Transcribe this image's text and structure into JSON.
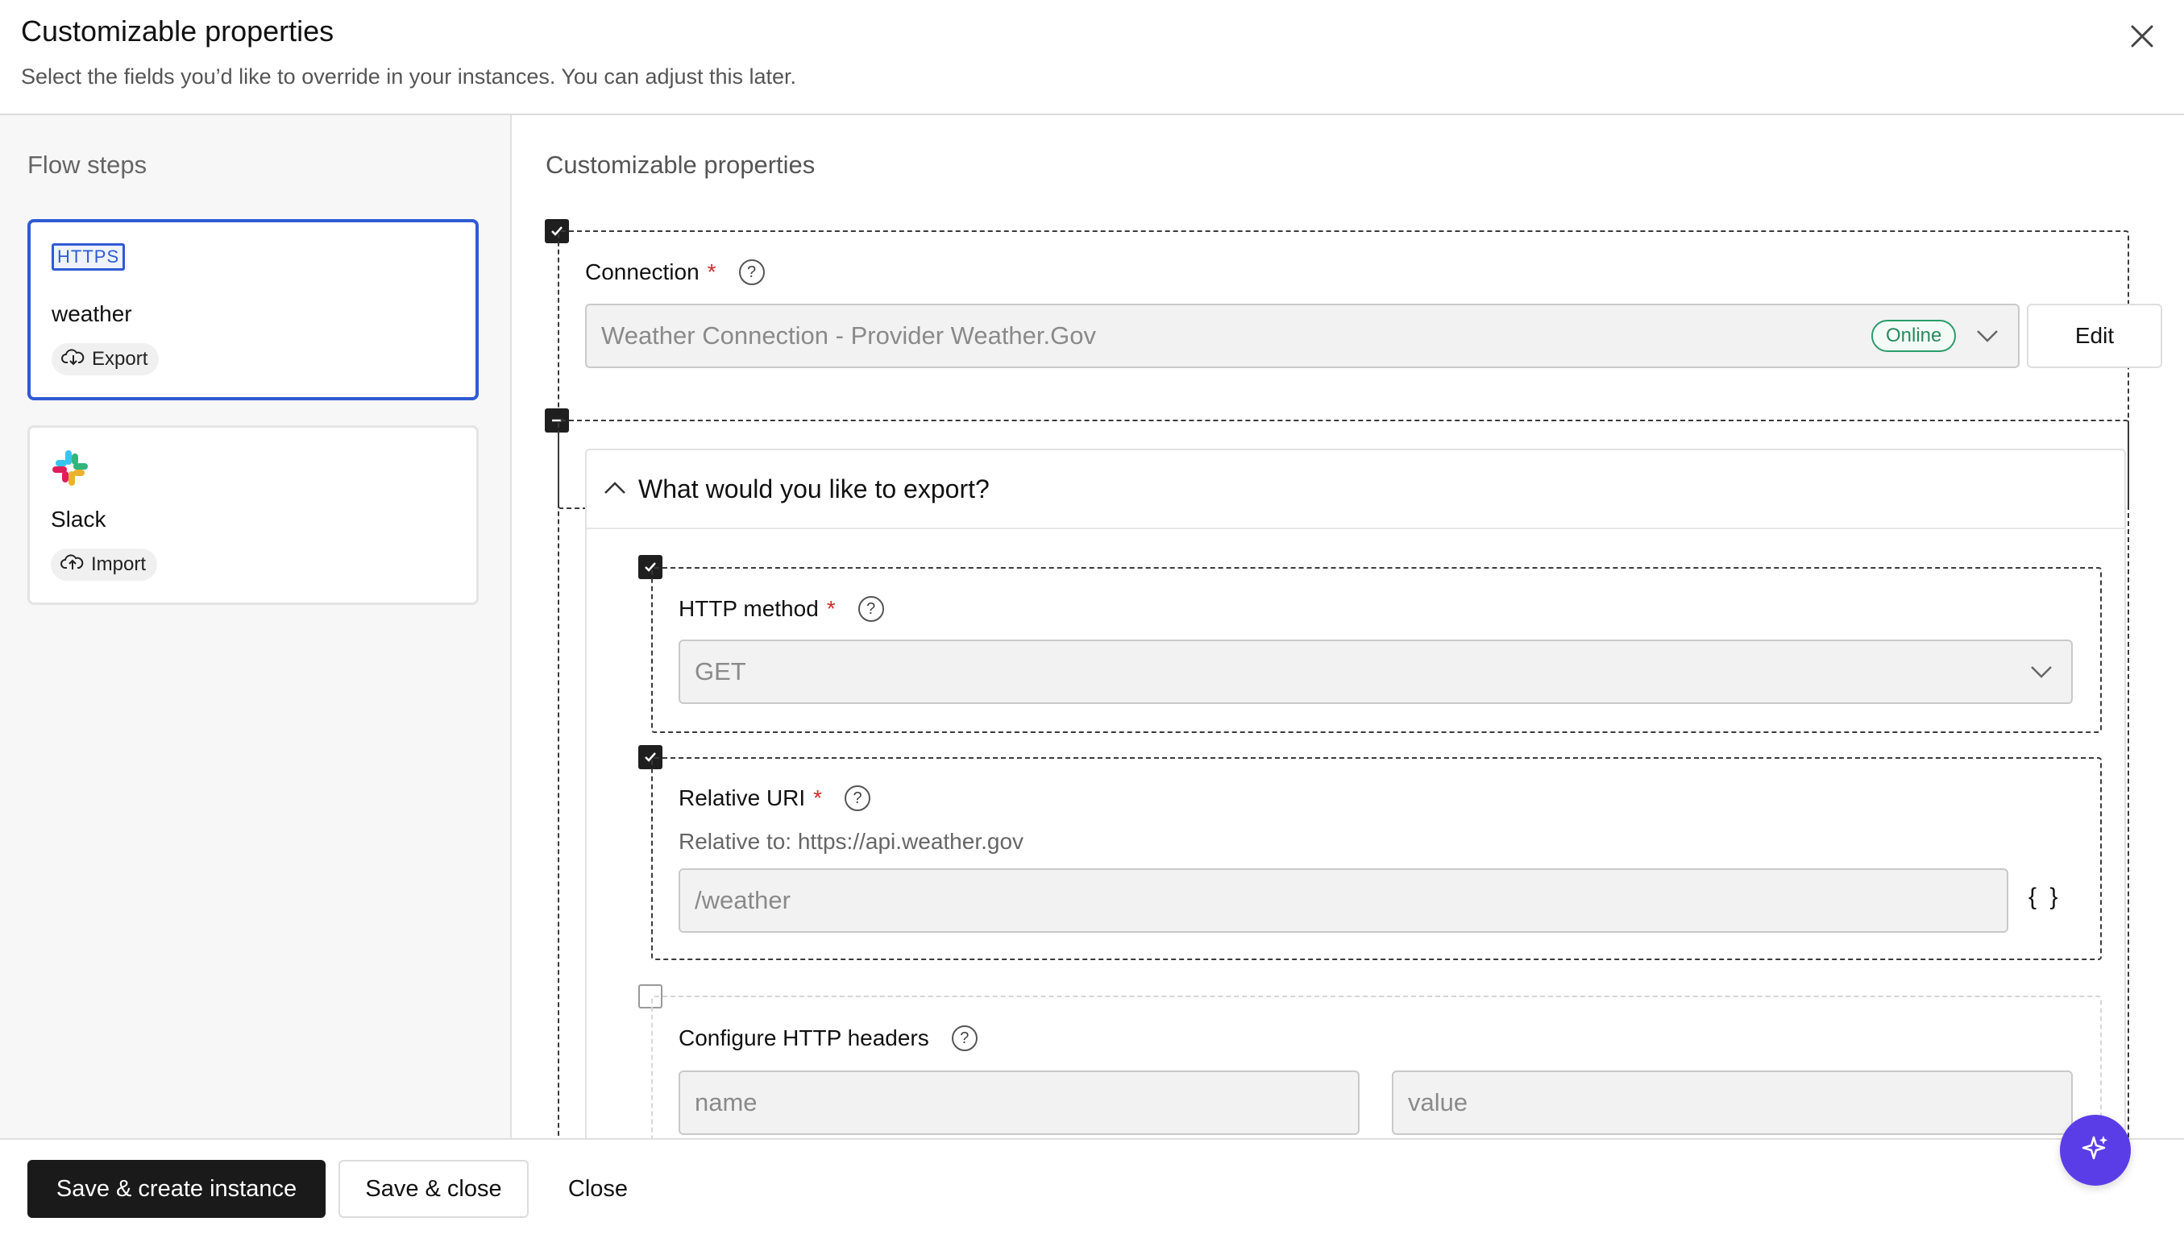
{
  "modal": {
    "title": "Customizable properties",
    "subtitle": "Select the fields you’d like to override in your instances. You can adjust this later."
  },
  "sidebar": {
    "title": "Flow steps",
    "steps": [
      {
        "icon": "https-icon",
        "icon_text": "HTTPS",
        "name": "weather",
        "badge": "Export",
        "badge_icon": "cloud-download-icon",
        "selected": true
      },
      {
        "icon": "slack-logo-icon",
        "name": "Slack",
        "badge": "Import",
        "badge_icon": "cloud-upload-icon",
        "selected": false
      }
    ]
  },
  "main": {
    "title": "Customizable properties",
    "connection": {
      "checked": true,
      "label": "Connection",
      "required_mark": "*",
      "value": "Weather Connection - Provider Weather.Gov",
      "status": "Online",
      "edit_label": "Edit"
    },
    "export_section": {
      "state": "indeterminate",
      "title": "What would you like to export?",
      "http_method": {
        "checked": true,
        "label": "HTTP method",
        "required_mark": "*",
        "value": "GET"
      },
      "relative_uri": {
        "checked": true,
        "label": "Relative URI",
        "required_mark": "*",
        "hint": "Relative to: https://api.weather.gov",
        "value": "/weather",
        "braces": "{ }"
      },
      "http_headers": {
        "checked": false,
        "label": "Configure HTTP headers",
        "name_placeholder": "name",
        "value_placeholder": "value"
      }
    }
  },
  "footer": {
    "primary": "Save & create instance",
    "secondary": "Save & close",
    "close": "Close"
  },
  "colors": {
    "accent_blue": "#2f5bd3",
    "online_green": "#2a9d6a",
    "fab_purple": "#5b3de8",
    "required_red": "#d02b2b"
  }
}
